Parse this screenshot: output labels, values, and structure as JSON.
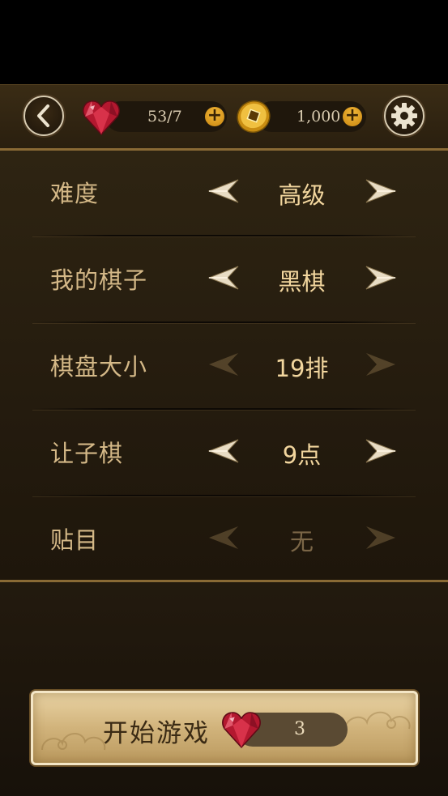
{
  "header": {
    "hearts_text": "53/7",
    "coins_text": "1,000",
    "plus_symbol": "+",
    "icons": {
      "back": "chevron-left-icon",
      "hearts": "ruby-heart-icon",
      "coins": "gold-coin-icon",
      "settings": "gear-icon"
    }
  },
  "settings": [
    {
      "label": "难度",
      "value": "高级",
      "enabled": true
    },
    {
      "label": "我的棋子",
      "value": "黑棋",
      "enabled": true
    },
    {
      "label": "棋盘大小",
      "value": "19排",
      "enabled": false
    },
    {
      "label": "让子棋",
      "value": "9点",
      "enabled": true
    },
    {
      "label": "贴目",
      "value": "无",
      "enabled": false
    }
  ],
  "start": {
    "label": "开始游戏",
    "cost": "3"
  },
  "colors": {
    "accent_gold": "#f2d69e",
    "label_gold": "#d4b887",
    "border_gold": "#8a6a35",
    "plus_orange": "#e0a020",
    "gem_red": "#c8203a"
  }
}
